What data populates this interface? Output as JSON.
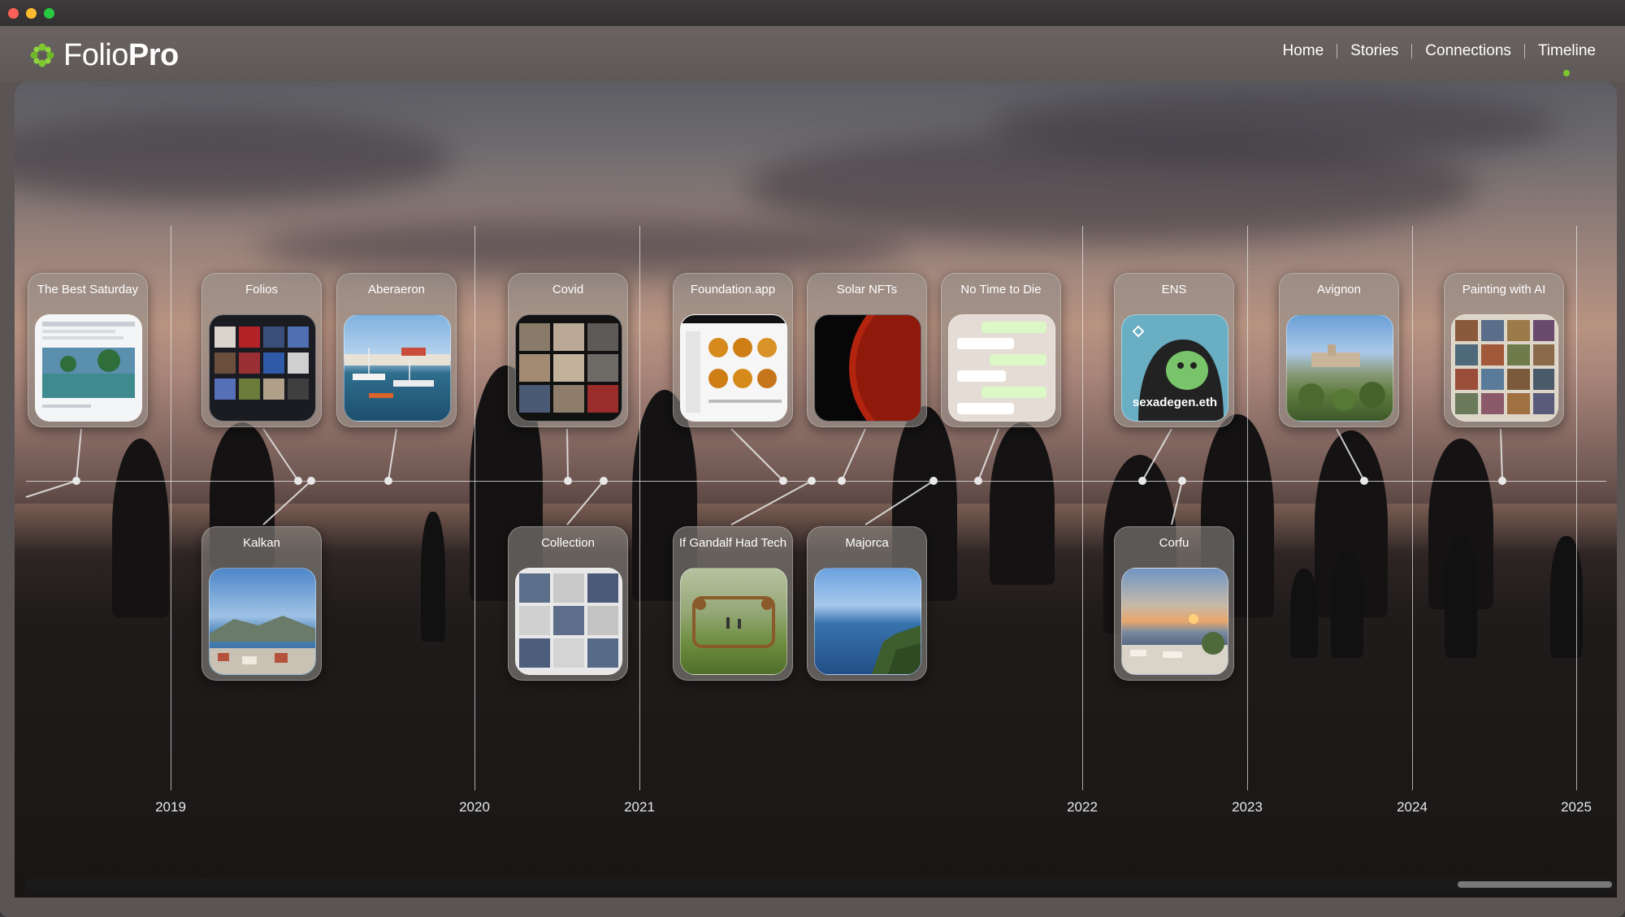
{
  "app": {
    "brand_light": "Folio",
    "brand_bold": "Pro",
    "brand_color": "#7ec82f"
  },
  "nav": {
    "items": [
      {
        "label": "Home"
      },
      {
        "label": "Stories"
      },
      {
        "label": "Connections"
      },
      {
        "label": "Timeline",
        "active": true
      }
    ]
  },
  "timeline": {
    "years": [
      "2019",
      "2020",
      "2021",
      "2022",
      "2023",
      "2024",
      "2025"
    ],
    "cards": [
      {
        "title": "The Best Saturday"
      },
      {
        "title": "Folios"
      },
      {
        "title": "Aberaeron"
      },
      {
        "title": "Covid"
      },
      {
        "title": "Foundation.app"
      },
      {
        "title": "Solar NFTs"
      },
      {
        "title": "No Time to Die"
      },
      {
        "title": "ENS",
        "caption": "sexadegen.eth"
      },
      {
        "title": "Avignon"
      },
      {
        "title": "Painting with AI"
      },
      {
        "title": "Kalkan"
      },
      {
        "title": "Collection"
      },
      {
        "title": "If Gandalf Had Tech"
      },
      {
        "title": "Majorca"
      },
      {
        "title": "Corfu"
      }
    ]
  }
}
